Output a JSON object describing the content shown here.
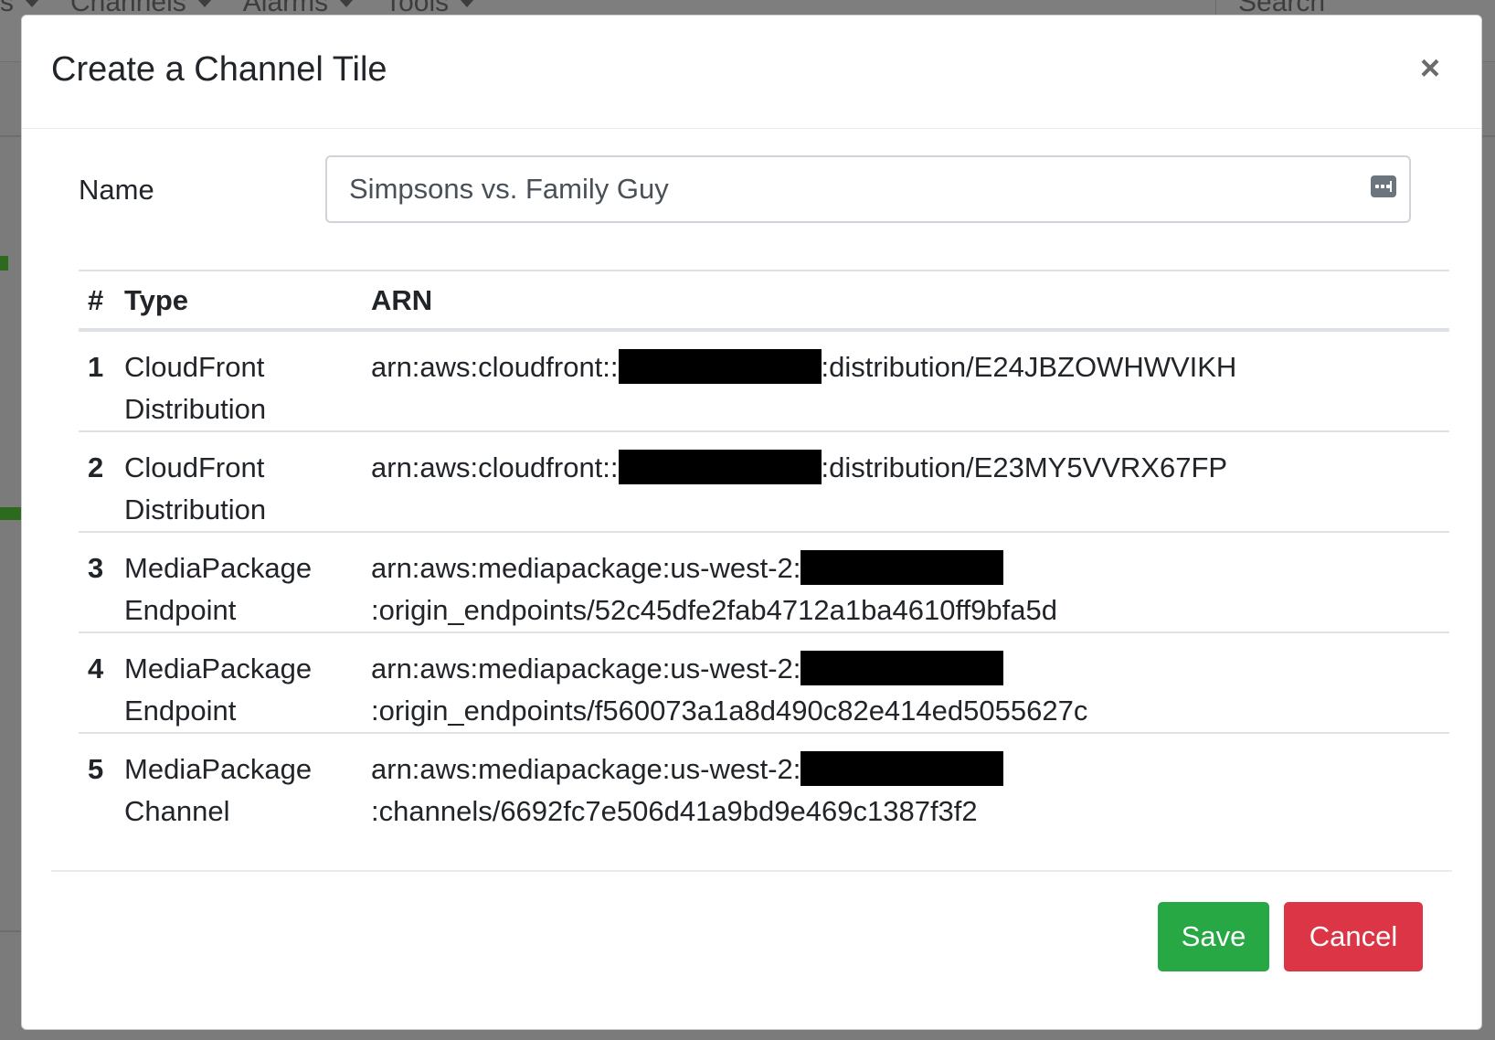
{
  "background": {
    "menu": [
      "s",
      "Channels",
      "Alarms",
      "Tools"
    ],
    "search_label": "Search"
  },
  "modal": {
    "title": "Create a Channel Tile",
    "close_label": "×",
    "name_label": "Name",
    "name_value": "Simpsons vs. Family Guy",
    "table": {
      "headers": [
        "#",
        "Type",
        "ARN"
      ],
      "rows": [
        {
          "num": "1",
          "type": [
            "CloudFront",
            "Distribution"
          ],
          "arn_prefix": "arn:aws:cloudfront::",
          "arn_suffix": ":distribution/E24JBZOWHWVIKH"
        },
        {
          "num": "2",
          "type": [
            "CloudFront",
            "Distribution"
          ],
          "arn_prefix": "arn:aws:cloudfront::",
          "arn_suffix": ":distribution/E23MY5VVRX67FP"
        },
        {
          "num": "3",
          "type": [
            "MediaPackage",
            "Endpoint"
          ],
          "arn_prefix": "arn:aws:mediapackage:us-west-2:",
          "arn_suffix": ":origin_endpoints/52c45dfe2fab4712a1ba4610ff9bfa5d"
        },
        {
          "num": "4",
          "type": [
            "MediaPackage",
            "Endpoint"
          ],
          "arn_prefix": "arn:aws:mediapackage:us-west-2:",
          "arn_suffix": ":origin_endpoints/f560073a1a8d490c82e414ed5055627c"
        },
        {
          "num": "5",
          "type": [
            "MediaPackage",
            "Channel"
          ],
          "arn_prefix": "arn:aws:mediapackage:us-west-2:",
          "arn_suffix": ":channels/6692fc7e506d41a9bd9e469c1387f3f2"
        }
      ]
    },
    "buttons": {
      "save": "Save",
      "cancel": "Cancel"
    },
    "colors": {
      "save": "#28a745",
      "cancel": "#dc3545",
      "redaction": "#000000"
    }
  }
}
